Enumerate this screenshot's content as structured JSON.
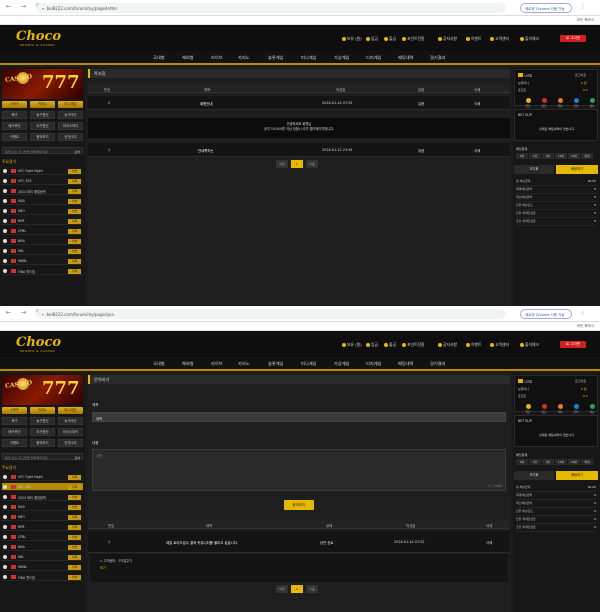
{
  "browser": {
    "url_1": "← bel8222.com/forum/my/page/letter",
    "url_2": "← bel8222.com/forum/my/page/qna",
    "chrome_button": "새로운 Chrome 사용 가능",
    "bookmarks": "모든 북마크"
  },
  "header": {
    "logo": "Choco",
    "logo_sub": "SPORTS & CASINO",
    "util": [
      "보유 (원)",
      "입금",
      "출금",
      "포인트전환",
      "공지사항",
      "이벤트",
      "고객센터",
      "출석체크"
    ],
    "login": "로 그아웃"
  },
  "main_nav": [
    "국내형",
    "해외형",
    "라이브",
    "카지노",
    "슬롯게임",
    "미니게임",
    "가상게임",
    "티지게임",
    "배팅내역",
    "경기결과"
  ],
  "left": {
    "banner_word": "CASINO",
    "banner_num": "777",
    "yellow_buttons": [
      "스포츠",
      "카지노",
      "미니게임"
    ],
    "grid_buttons": [
      "축구",
      "농구원신",
      "농구여신",
      "배구포인",
      "야구원신",
      "아이스하키",
      "이벳트",
      "음악보기",
      "안전나리"
    ],
    "search_placeholder": "팀명 또는 리그명을 입력해주세요",
    "search_btn": "검색",
    "section_title": "주요경기",
    "games": [
      "UFC Fight Night",
      "UFC 305",
      "2024 파리 패럴림픽",
      "MLB",
      "KBO",
      "NPB",
      "CPBL",
      "NBA",
      "KBL",
      "WKBL",
      "FIBA 월드컵"
    ],
    "game_btn": "전체"
  },
  "screen1": {
    "panel_title": "쪽지함",
    "columns": [
      "번호",
      "제목",
      "작성일",
      "읽음",
      "삭제"
    ],
    "rows": [
      {
        "no": "2",
        "title": "회원안내",
        "date": "2024-01-14 07:02",
        "read": "읽음",
        "del": "삭제"
      },
      {
        "no": "1",
        "title": "안내쪽지는",
        "date": "2024-01-12 23:34",
        "read": "읽음",
        "del": "삭제"
      }
    ],
    "notice_1": "안녕하세요 회원님",
    "notice_2": "공지 19,000원 이상 당첨시 추가 앱티케이치형니다.",
    "pager": [
      "이전",
      "1",
      "다음"
    ]
  },
  "screen2": {
    "panel_title": "문의하기",
    "label_title": "제목",
    "input_title": "제목",
    "label_content": "내용",
    "textarea_placeholder": "내용",
    "textarea_count": "0 / 2000",
    "submit": "문의하기",
    "columns": [
      "번호",
      "제목",
      "상태",
      "작성일",
      "삭제"
    ],
    "row": {
      "no": "1",
      "title": "데일 트리드갈수 결과 커뮤니티를 올리고 싶습니다.",
      "status": "답변 완료",
      "date": "2024-01-14 07:02",
      "del": "삭제"
    },
    "reply_1": "↳ 고객센터 : 1이일주기",
    "reply_2": "보기",
    "pager": [
      "이전",
      "1",
      "다음"
    ]
  },
  "right": {
    "level": "LV1",
    "user": "닉네임",
    "logout": "로그아웃",
    "money_label": "보유머니",
    "money_val": "0 원",
    "point_label": "포인트",
    "point_val": "0 P",
    "coins": [
      "입금",
      "출금",
      "쪽지",
      "문의",
      "정보"
    ],
    "coin_colors": [
      "#e6b800",
      "#d03030",
      "#e08020",
      "#2b7bd0",
      "#30a050"
    ],
    "slip_title": "BET SLIP",
    "slip_msg": "선택된 배팅내역이 없습니다.",
    "odds_title": "배당합계",
    "amount_buttons": [
      "5천",
      "1만",
      "5만",
      "10만",
      "50만",
      "최대"
    ],
    "btn_reset": "초기화",
    "btn_bet": "배팅하기",
    "stats": [
      {
        "label": "총 배팅금액",
        "val": "0"
      },
      {
        "label": "최대배팅금액",
        "val": "0"
      },
      {
        "label": "최소배팅금액",
        "val": "0"
      },
      {
        "label": "단폴 배팅한도",
        "val": "0"
      },
      {
        "label": "단폴 최대당첨금",
        "val": "0"
      },
      {
        "label": "조합 최대당첨금",
        "val": "0"
      }
    ],
    "stat_total_val": "00.00"
  }
}
